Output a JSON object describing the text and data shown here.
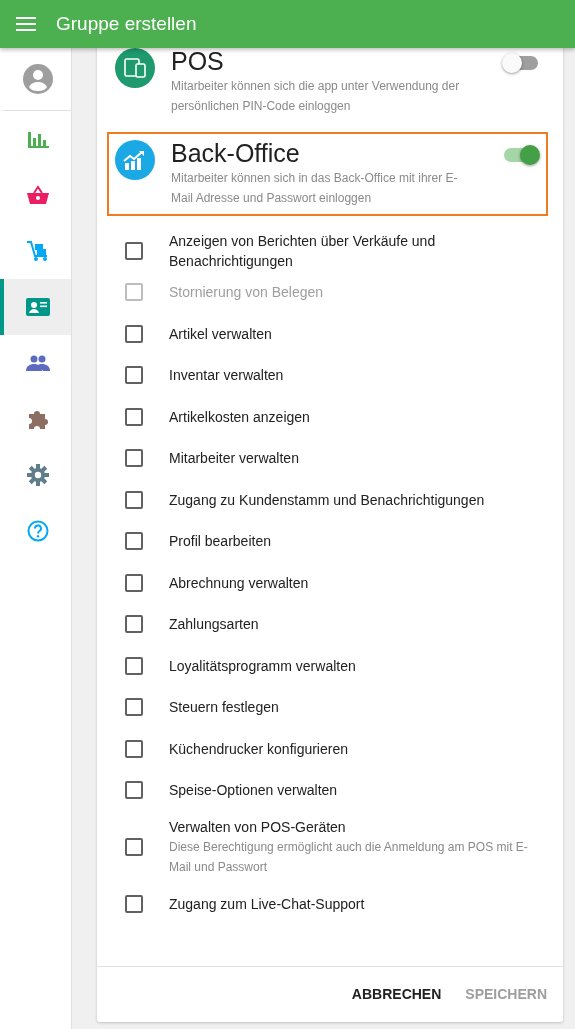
{
  "app_bar": {
    "title": "Gruppe erstellen"
  },
  "sidebar": {
    "items": [
      {
        "kind": "avatar",
        "selected": false
      },
      {
        "kind": "chart",
        "selected": false
      },
      {
        "kind": "basket",
        "selected": false
      },
      {
        "kind": "cart",
        "selected": false
      },
      {
        "kind": "card",
        "selected": true
      },
      {
        "kind": "people",
        "selected": false
      },
      {
        "kind": "puzzle",
        "selected": false
      },
      {
        "kind": "gear",
        "selected": false
      },
      {
        "kind": "help",
        "selected": false
      }
    ]
  },
  "sections": [
    {
      "kind": "pos",
      "title": "POS",
      "description": "Mitarbeiter können sich die app unter Verwendung der persönlichen PIN-Code einloggen",
      "on": false,
      "highlighted": false
    },
    {
      "kind": "backoffice",
      "title": "Back-Office",
      "description": "Mitarbeiter können sich in das Back-Office mit ihrer E-Mail Adresse und Passwort einloggen",
      "on": true,
      "highlighted": true
    }
  ],
  "permissions": [
    {
      "label": "Anzeigen von Berichten über Verkäufe und Benachrichtigungen",
      "checked": false,
      "disabled": false
    },
    {
      "label": "Stornierung von Belegen",
      "checked": false,
      "disabled": true
    },
    {
      "label": "Artikel verwalten",
      "checked": false,
      "disabled": false
    },
    {
      "label": "Inventar verwalten",
      "checked": false,
      "disabled": false
    },
    {
      "label": "Artikelkosten anzeigen",
      "checked": false,
      "disabled": false
    },
    {
      "label": "Mitarbeiter verwalten",
      "checked": false,
      "disabled": false
    },
    {
      "label": "Zugang zu Kundenstamm und Benachrichtigungen",
      "checked": false,
      "disabled": false
    },
    {
      "label": "Profil bearbeiten",
      "checked": false,
      "disabled": false
    },
    {
      "label": "Abrechnung verwalten",
      "checked": false,
      "disabled": false
    },
    {
      "label": "Zahlungsarten",
      "checked": false,
      "disabled": false
    },
    {
      "label": "Loyalitätsprogramm verwalten",
      "checked": false,
      "disabled": false
    },
    {
      "label": "Steuern festlegen",
      "checked": false,
      "disabled": false
    },
    {
      "label": "Küchendrucker konfigurieren",
      "checked": false,
      "disabled": false
    },
    {
      "label": "Speise-Optionen verwalten",
      "checked": false,
      "disabled": false
    },
    {
      "label": "Verwalten von POS-Geräten",
      "description": "Diese Berechtigung ermöglicht auch die Anmeldung am POS mit E-Mail und Passwort",
      "checked": false,
      "disabled": false
    },
    {
      "label": "Zugang zum Live-Chat-Support",
      "checked": false,
      "disabled": false
    }
  ],
  "actions": [
    {
      "label": "ABBRECHEN",
      "disabled": false
    },
    {
      "label": "SPEICHERN",
      "disabled": true
    }
  ]
}
